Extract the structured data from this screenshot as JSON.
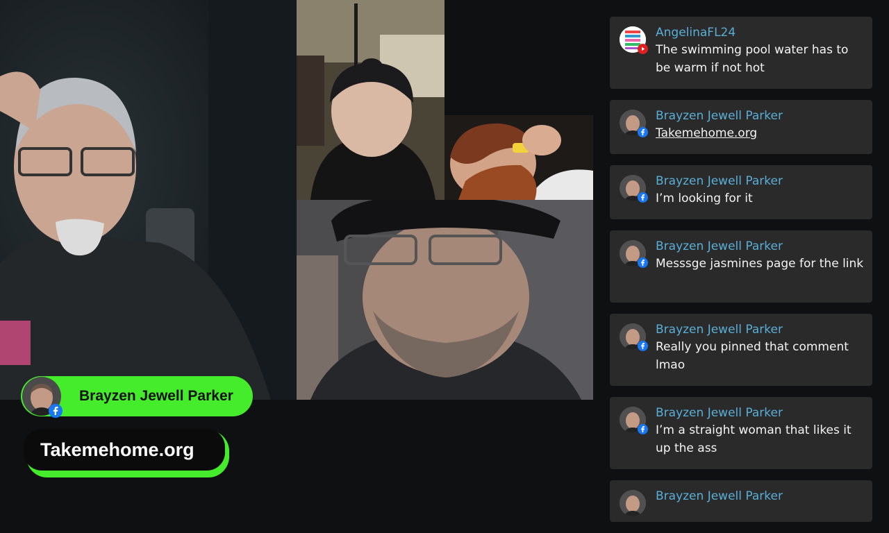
{
  "overlay": {
    "presenter_name": "Brayzen Jewell Parker",
    "presenter_platform_icon": "facebook-icon",
    "website": "Takemehome.org",
    "accent_color": "#44ec2c"
  },
  "chat": {
    "messages": [
      {
        "author": "AngelinaFL24",
        "text": "The swimming pool water has to be warm if not hot",
        "platform": "youtube-icon"
      },
      {
        "author": "Brayzen Jewell Parker",
        "text": "Takemehome.org",
        "platform": "facebook-icon"
      },
      {
        "author": "Brayzen Jewell Parker",
        "text": "I’m looking for it",
        "platform": "facebook-icon"
      },
      {
        "author": "Brayzen Jewell Parker",
        "text": "Messsge jasmines page for the link",
        "platform": "facebook-icon"
      },
      {
        "author": "Brayzen Jewell Parker",
        "text": "Really you pinned that comment lmao",
        "platform": "facebook-icon"
      },
      {
        "author": "Brayzen Jewell Parker",
        "text": "I’m a straight woman that likes it up the ass ￼",
        "platform": "facebook-icon"
      },
      {
        "author": "Brayzen Jewell Parker",
        "text": "",
        "platform": "facebook-icon"
      }
    ],
    "author_color": "#5aaed6",
    "bubble_color": "#2a2a2a"
  }
}
